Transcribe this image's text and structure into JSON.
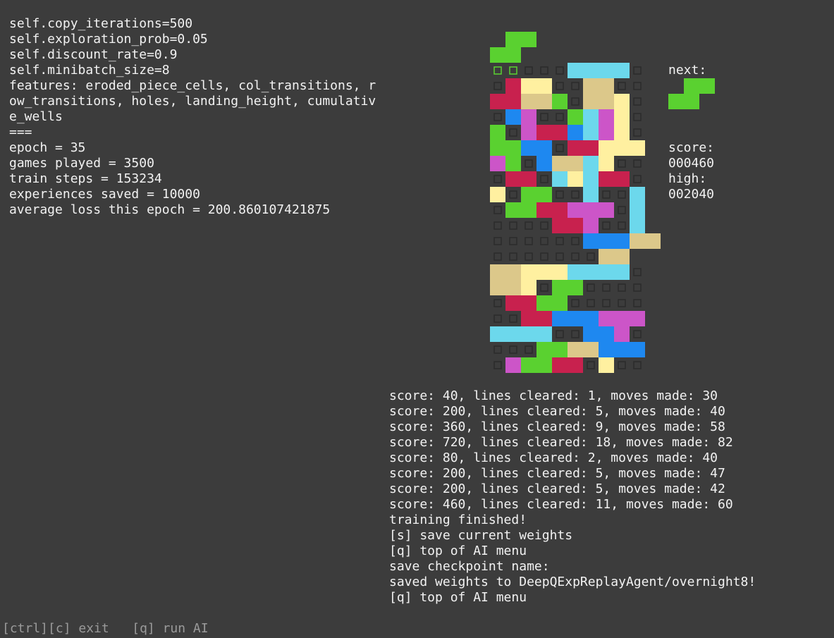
{
  "info_lines": [
    "self.copy_iterations=500",
    "self.exploration_prob=0.05",
    "self.discount_rate=0.9",
    "self.minibatch_size=8",
    "features: eroded_piece_cells, col_transitions, r",
    "ow_transitions, holes, landing_height, cumulativ",
    "e_wells",
    "===",
    "epoch = 35",
    "games played = 3500",
    "train steps = 153234",
    "experiences saved = 10000",
    "average loss this epoch = 200.860107421875"
  ],
  "sidebar": {
    "next_label": "next:",
    "score_label": "score:",
    "score_value": "000460",
    "high_label": "high:",
    "high_value": "002040"
  },
  "log_lines": [
    "score: 40, lines cleared: 1, moves made: 30",
    "score: 200, lines cleared: 5, moves made: 40",
    "score: 360, lines cleared: 9, moves made: 58",
    "score: 720, lines cleared: 18, moves made: 82",
    "score: 80, lines cleared: 2, moves made: 40",
    "score: 200, lines cleared: 5, moves made: 47",
    "score: 200, lines cleared: 5, moves made: 42",
    "score: 460, lines cleared: 11, moves made: 60",
    "training finished!",
    "[s] save current weights",
    "[q] top of AI menu",
    "save checkpoint name:",
    "saved weights to DeepQExpReplayAgent/overnight8!",
    "[q] top of AI menu"
  ],
  "footer": "[ctrl][c] exit   [q] run AI",
  "colors": {
    "background": "#3c3c3c",
    "G": "#5ad130",
    "R": "#c8214e",
    "Y": "#fff0a0",
    "T": "#dcc88a",
    "C": "#6cd8ec",
    "B": "#1e88f0",
    "M": "#cc55c8"
  },
  "board": {
    "legend": {
      ".": "empty",
      "o": "ghost",
      "G": "green",
      "R": "red",
      "Y": "yellow",
      "T": "tan",
      "C": "cyan",
      "B": "blue",
      "M": "magenta"
    },
    "active_piece": [
      ".GG",
      "GG."
    ],
    "rows": [
      "oo...CCCC.",
      ".RYY..TT..",
      "RRTTG.TTY.",
      ".BM..GCMY.",
      "G.MRRBCMY.",
      "GGBB.RRYYY",
      "MG.BTTCY..",
      ".RR.CYCRR.",
      "Y.GG..C..C",
      ".GGRRMMM.C",
      "....RRM..C",
      "......BBBTT",
      ".......TT",
      "TTYYYCCCC.",
      "TTY.GG....",
      ".RRGG.....",
      "..RRBBBMMM",
      "CCCC..BBM.",
      "...GGTTBBB",
      ".MGGRR.Y.."
    ]
  },
  "next_piece": [
    ".GG",
    "GG."
  ]
}
